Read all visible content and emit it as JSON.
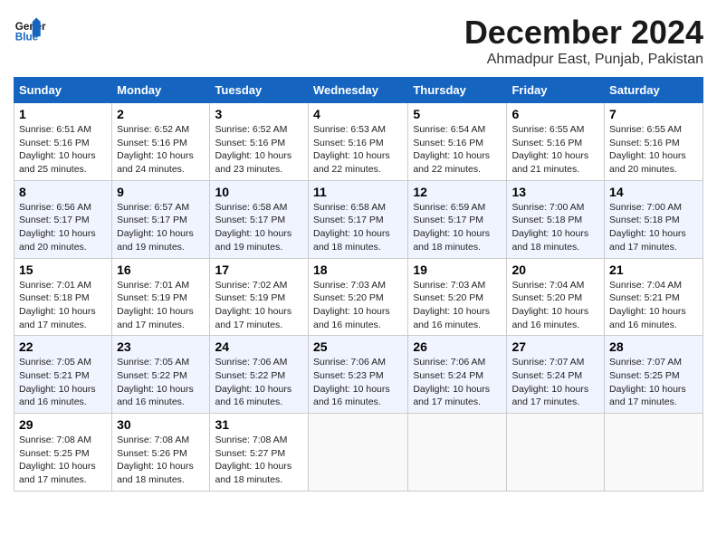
{
  "logo": {
    "line1": "General",
    "line2": "Blue"
  },
  "title": "December 2024",
  "subtitle": "Ahmadpur East, Punjab, Pakistan",
  "weekdays": [
    "Sunday",
    "Monday",
    "Tuesday",
    "Wednesday",
    "Thursday",
    "Friday",
    "Saturday"
  ],
  "weeks": [
    [
      {
        "day": "1",
        "sunrise": "6:51 AM",
        "sunset": "5:16 PM",
        "daylight": "10 hours and 25 minutes."
      },
      {
        "day": "2",
        "sunrise": "6:52 AM",
        "sunset": "5:16 PM",
        "daylight": "10 hours and 24 minutes."
      },
      {
        "day": "3",
        "sunrise": "6:52 AM",
        "sunset": "5:16 PM",
        "daylight": "10 hours and 23 minutes."
      },
      {
        "day": "4",
        "sunrise": "6:53 AM",
        "sunset": "5:16 PM",
        "daylight": "10 hours and 22 minutes."
      },
      {
        "day": "5",
        "sunrise": "6:54 AM",
        "sunset": "5:16 PM",
        "daylight": "10 hours and 22 minutes."
      },
      {
        "day": "6",
        "sunrise": "6:55 AM",
        "sunset": "5:16 PM",
        "daylight": "10 hours and 21 minutes."
      },
      {
        "day": "7",
        "sunrise": "6:55 AM",
        "sunset": "5:16 PM",
        "daylight": "10 hours and 20 minutes."
      }
    ],
    [
      {
        "day": "8",
        "sunrise": "6:56 AM",
        "sunset": "5:17 PM",
        "daylight": "10 hours and 20 minutes."
      },
      {
        "day": "9",
        "sunrise": "6:57 AM",
        "sunset": "5:17 PM",
        "daylight": "10 hours and 19 minutes."
      },
      {
        "day": "10",
        "sunrise": "6:58 AM",
        "sunset": "5:17 PM",
        "daylight": "10 hours and 19 minutes."
      },
      {
        "day": "11",
        "sunrise": "6:58 AM",
        "sunset": "5:17 PM",
        "daylight": "10 hours and 18 minutes."
      },
      {
        "day": "12",
        "sunrise": "6:59 AM",
        "sunset": "5:17 PM",
        "daylight": "10 hours and 18 minutes."
      },
      {
        "day": "13",
        "sunrise": "7:00 AM",
        "sunset": "5:18 PM",
        "daylight": "10 hours and 18 minutes."
      },
      {
        "day": "14",
        "sunrise": "7:00 AM",
        "sunset": "5:18 PM",
        "daylight": "10 hours and 17 minutes."
      }
    ],
    [
      {
        "day": "15",
        "sunrise": "7:01 AM",
        "sunset": "5:18 PM",
        "daylight": "10 hours and 17 minutes."
      },
      {
        "day": "16",
        "sunrise": "7:01 AM",
        "sunset": "5:19 PM",
        "daylight": "10 hours and 17 minutes."
      },
      {
        "day": "17",
        "sunrise": "7:02 AM",
        "sunset": "5:19 PM",
        "daylight": "10 hours and 17 minutes."
      },
      {
        "day": "18",
        "sunrise": "7:03 AM",
        "sunset": "5:20 PM",
        "daylight": "10 hours and 16 minutes."
      },
      {
        "day": "19",
        "sunrise": "7:03 AM",
        "sunset": "5:20 PM",
        "daylight": "10 hours and 16 minutes."
      },
      {
        "day": "20",
        "sunrise": "7:04 AM",
        "sunset": "5:20 PM",
        "daylight": "10 hours and 16 minutes."
      },
      {
        "day": "21",
        "sunrise": "7:04 AM",
        "sunset": "5:21 PM",
        "daylight": "10 hours and 16 minutes."
      }
    ],
    [
      {
        "day": "22",
        "sunrise": "7:05 AM",
        "sunset": "5:21 PM",
        "daylight": "10 hours and 16 minutes."
      },
      {
        "day": "23",
        "sunrise": "7:05 AM",
        "sunset": "5:22 PM",
        "daylight": "10 hours and 16 minutes."
      },
      {
        "day": "24",
        "sunrise": "7:06 AM",
        "sunset": "5:22 PM",
        "daylight": "10 hours and 16 minutes."
      },
      {
        "day": "25",
        "sunrise": "7:06 AM",
        "sunset": "5:23 PM",
        "daylight": "10 hours and 16 minutes."
      },
      {
        "day": "26",
        "sunrise": "7:06 AM",
        "sunset": "5:24 PM",
        "daylight": "10 hours and 17 minutes."
      },
      {
        "day": "27",
        "sunrise": "7:07 AM",
        "sunset": "5:24 PM",
        "daylight": "10 hours and 17 minutes."
      },
      {
        "day": "28",
        "sunrise": "7:07 AM",
        "sunset": "5:25 PM",
        "daylight": "10 hours and 17 minutes."
      }
    ],
    [
      {
        "day": "29",
        "sunrise": "7:08 AM",
        "sunset": "5:25 PM",
        "daylight": "10 hours and 17 minutes."
      },
      {
        "day": "30",
        "sunrise": "7:08 AM",
        "sunset": "5:26 PM",
        "daylight": "10 hours and 18 minutes."
      },
      {
        "day": "31",
        "sunrise": "7:08 AM",
        "sunset": "5:27 PM",
        "daylight": "10 hours and 18 minutes."
      },
      null,
      null,
      null,
      null
    ]
  ]
}
